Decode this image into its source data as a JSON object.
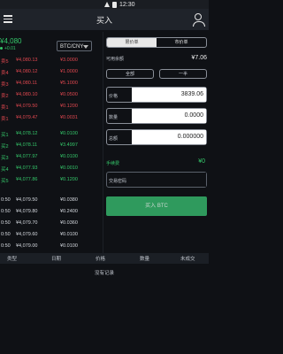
{
  "header": {
    "title": "买入",
    "time": "12:30"
  },
  "market": {
    "last_price": "¥4,080",
    "change": "+0.01",
    "pair": "BTC/CNY"
  },
  "orderbook": {
    "asks": [
      {
        "index": "卖5",
        "price": "¥4,080.13",
        "qty": "¥3.0000"
      },
      {
        "index": "卖4",
        "price": "¥4,080.12",
        "qty": "¥1.0000"
      },
      {
        "index": "卖3",
        "price": "¥4,080.11",
        "qty": "¥5.1000"
      },
      {
        "index": "卖2",
        "price": "¥4,080.10",
        "qty": "¥0.0500"
      },
      {
        "index": "卖1",
        "price": "¥4,079.50",
        "qty": "¥0.1200"
      },
      {
        "index": "卖1",
        "price": "¥4,079.47",
        "qty": "¥0.0031"
      }
    ],
    "bids": [
      {
        "index": "买1",
        "price": "¥4,078.12",
        "qty": "¥0.0100"
      },
      {
        "index": "买2",
        "price": "¥4,078.11",
        "qty": "¥3.4997"
      },
      {
        "index": "买3",
        "price": "¥4,077.97",
        "qty": "¥0.0100"
      },
      {
        "index": "买4",
        "price": "¥4,077.93",
        "qty": "¥0.0010"
      },
      {
        "index": "买5",
        "price": "¥4,077.86",
        "qty": "¥0.1200"
      }
    ]
  },
  "trades": [
    {
      "time": "0:50",
      "price": "¥4,079.50",
      "qty": "¥0.0380"
    },
    {
      "time": "0:50",
      "price": "¥4,079.80",
      "qty": "¥0.2400"
    },
    {
      "time": "0:50",
      "price": "¥4,079.70",
      "qty": "¥0.0360"
    },
    {
      "time": "0:50",
      "price": "¥4,079.60",
      "qty": "¥0.0100"
    },
    {
      "time": "0:50",
      "price": "¥4,079.00",
      "qty": "¥0.0100"
    }
  ],
  "form": {
    "tab_limit": "限价单",
    "tab_market": "市价单",
    "available_cny_label": "可用余额",
    "available_cny": "¥7.06",
    "btn_all": "全部",
    "btn_half": "一半",
    "price_label": "价格",
    "price_value": "3839.06",
    "amount_label": "数量",
    "amount_value": "0.0000",
    "total_label": "总额",
    "total_value": "0.000000",
    "fee_label": "手续费",
    "fee_value": "¥0",
    "trade_pwd_label": "交易密码",
    "submit": "买入 BTC"
  },
  "bottom_bar": {
    "c1": "类型",
    "c2": "日期",
    "c3": "价格",
    "c4": "数量",
    "c5": "未成交"
  },
  "empty_state": "没有记录"
}
